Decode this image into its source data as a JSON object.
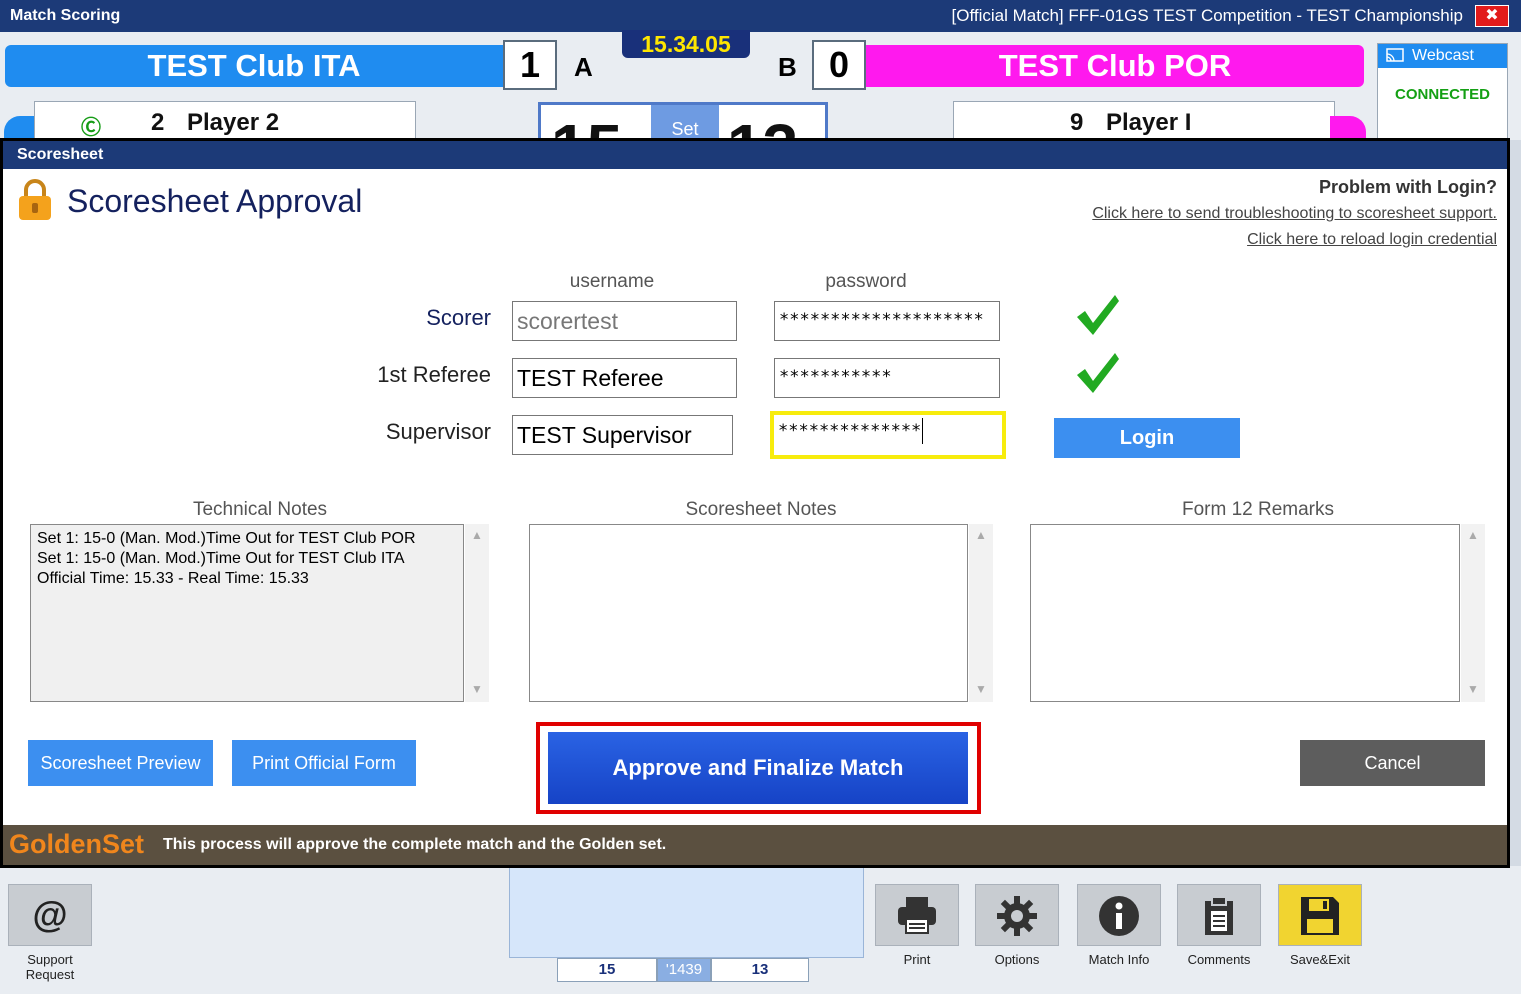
{
  "window": {
    "title": "Match Scoring",
    "match_info": "[Official Match]  FFF-01GS   TEST Competition - TEST Championship",
    "close_glyph": "✖"
  },
  "match": {
    "team_a": {
      "name": "TEST Club ITA",
      "sets": "1",
      "side": "A",
      "color": "#1f8cf0"
    },
    "team_b": {
      "name": "TEST Club POR",
      "sets": "0",
      "side": "B",
      "color": "#ff19ee"
    },
    "clock": "15.34.05",
    "player_a": {
      "captain": "Ⓒ",
      "number": "2",
      "name": "Player 2"
    },
    "player_b": {
      "number": "9",
      "name": "Player I"
    },
    "set_label": "Set",
    "set_score_a": "15",
    "set_score_b": "13"
  },
  "webcast": {
    "label": "Webcast",
    "status": "CONNECTED"
  },
  "dialog": {
    "title": "Scoresheet",
    "heading": "Scoresheet Approval",
    "help_title": "Problem with Login?",
    "help_link_support": "Click here to send troubleshooting to scoresheet support.",
    "help_link_reload": "Click here to reload login credential",
    "col_username": "username",
    "col_password": "password",
    "rows": [
      {
        "label": "Scorer",
        "username": "scorertest",
        "password": "********************",
        "verified": true
      },
      {
        "label": "1st Referee",
        "username": "TEST Referee",
        "password": "***********",
        "verified": true
      },
      {
        "label": "Supervisor",
        "username": "TEST Supervisor",
        "password": "**************",
        "verified": false
      }
    ],
    "login_label": "Login",
    "notes": {
      "technical_title": "Technical Notes",
      "technical_lines": [
        "Set 1: 15-0 (Man. Mod.)Time Out for TEST Club POR",
        "Set 1: 15-0 (Man. Mod.)Time Out for TEST Club ITA",
        "Official Time:  15.33  -  Real Time:  15.33"
      ],
      "scoresheet_title": "Scoresheet Notes",
      "form12_title": "Form 12 Remarks"
    },
    "preview_label": "Scoresheet Preview",
    "print_form_label": "Print Official Form",
    "approve_label": "Approve and Finalize Match",
    "cancel_label": "Cancel",
    "footer_logo": "GoldenSet",
    "footer_message": "This process will approve the complete match and the Golden set."
  },
  "bottom": {
    "support_label_1": "Support",
    "support_label_2": "Request",
    "mini_score_a": "15",
    "mini_time": "'1439",
    "mini_score_b": "13",
    "print_label": "Print",
    "options_label": "Options",
    "match_info_label": "Match Info",
    "comments_label": "Comments",
    "save_exit_label": "Save&Exit"
  },
  "colors": {
    "title_bar": "#1c3a78",
    "accent_blue": "#3c8ff0",
    "approve_blue": "#1643c6",
    "highlight_red": "#e00000",
    "focus_yellow": "#f7ec0d",
    "check_green": "#22aa22",
    "golden_orange": "#f0861c"
  }
}
